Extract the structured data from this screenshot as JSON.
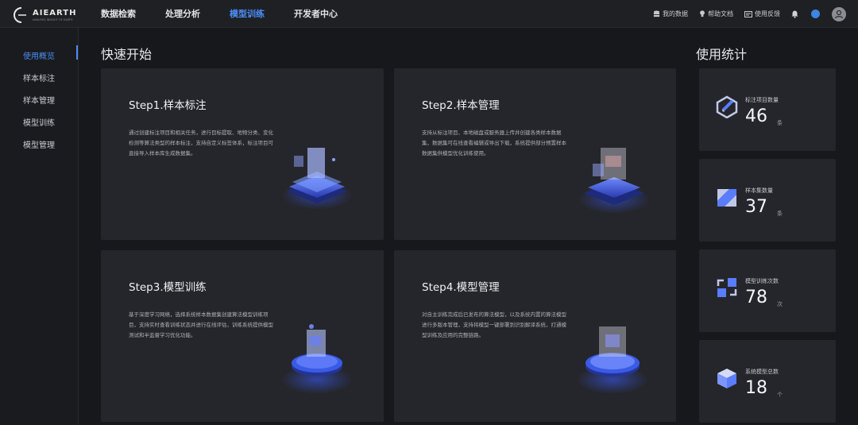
{
  "header": {
    "logo_text": "AIEARTH",
    "logo_sub": "ANALYSIS INSIGHT OF EARTH",
    "nav": [
      {
        "label": "数据检索",
        "active": false
      },
      {
        "label": "处理分析",
        "active": false
      },
      {
        "label": "模型训练",
        "active": true
      },
      {
        "label": "开发者中心",
        "active": false
      }
    ],
    "right": {
      "my_data": "我的数据",
      "help": "帮助文档",
      "feedback": "使用反馈"
    }
  },
  "sidebar": {
    "items": [
      {
        "label": "使用概览",
        "active": true
      },
      {
        "label": "样本标注",
        "active": false
      },
      {
        "label": "样本管理",
        "active": false
      },
      {
        "label": "模型训练",
        "active": false
      },
      {
        "label": "模型管理",
        "active": false
      }
    ]
  },
  "quickstart": {
    "title": "快速开始",
    "steps": [
      {
        "title": "Step1.样本标注",
        "desc": "通过创建标注项目和相关任务，进行目标提取、地物分类、变化检测等算法类型的样本标注，支持自定义标签体系，标注项目可直接导入样本库生成数据集。",
        "icon": "annotation-illustration"
      },
      {
        "title": "Step2.样本管理",
        "desc": "支持从标注项目、本地磁盘或服务器上传并创建各类样本数据集，数据集可在线查看编辑或导出下载，系统提供部分预置样本数据集供模型优化训练使用。",
        "icon": "sample-management-illustration"
      },
      {
        "title": "Step3.模型训练",
        "desc": "基于深度学习网络，选择系统样本数据集创建算法模型训练项目，支持实时查看训练状态并进行在线评估，训练系统提供模型测试和半监督学习优化功能。",
        "icon": "model-training-illustration"
      },
      {
        "title": "Step4.模型管理",
        "desc": "对自主训练完成后已发布的算法模型，以及系统内置的算法模型进行多版本管理，支持将模型一键部署到识别解译系统，打通模型训练及应用的完整链路。",
        "icon": "model-management-illustration"
      }
    ]
  },
  "stats": {
    "title": "使用统计",
    "items": [
      {
        "label": "标注项目数量",
        "value": "46",
        "unit": "条",
        "icon": "annotation-icon"
      },
      {
        "label": "样本集数量",
        "value": "37",
        "unit": "条",
        "icon": "sample-set-icon"
      },
      {
        "label": "模型训练次数",
        "value": "78",
        "unit": "次",
        "icon": "training-cycle-icon"
      },
      {
        "label": "系统模型总数",
        "value": "18",
        "unit": "个",
        "icon": "model-cube-icon"
      }
    ]
  },
  "colors": {
    "accent": "#4c8df6",
    "background": "#17181c",
    "card": "#25262b"
  }
}
